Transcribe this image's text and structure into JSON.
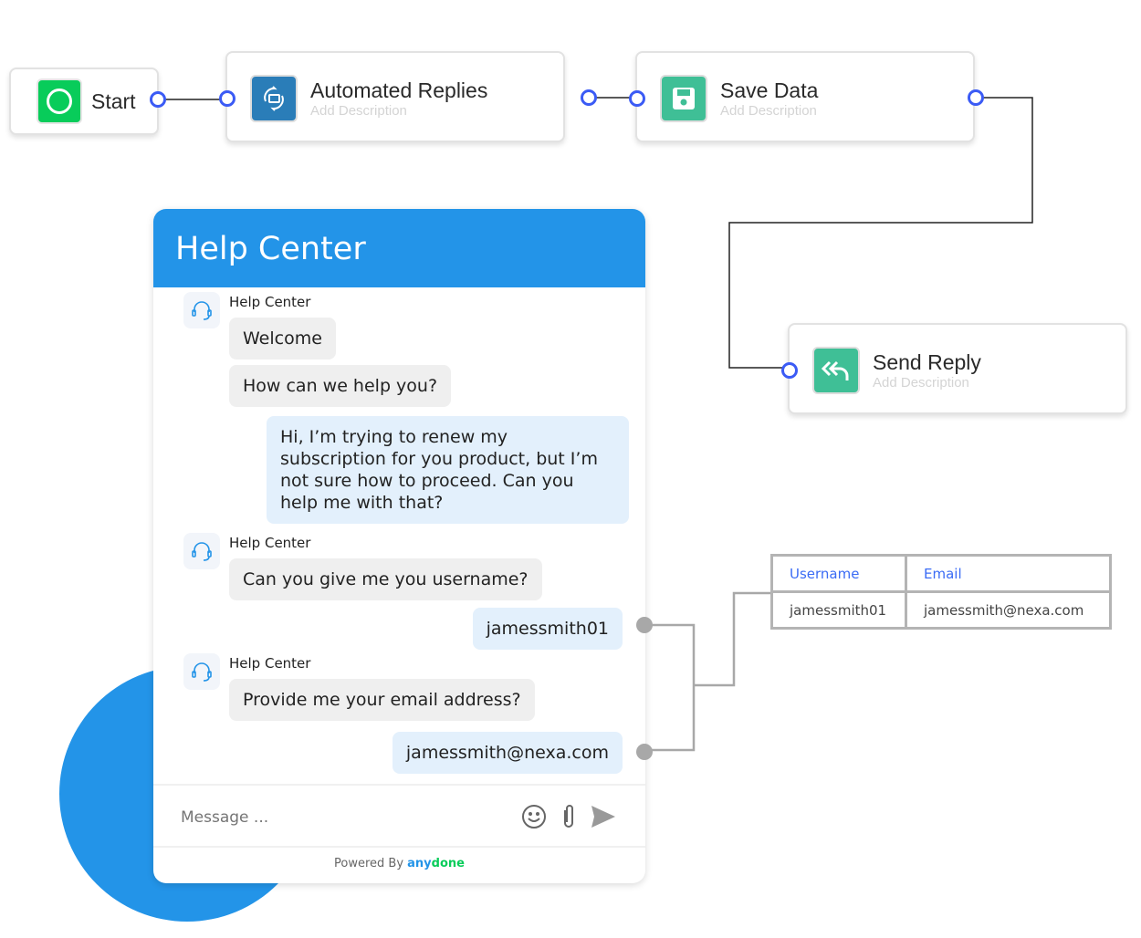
{
  "flow": {
    "start": {
      "label": "Start",
      "color": "#08cc5a"
    },
    "nodes": [
      {
        "title": "Automated Replies",
        "description": "Add Description",
        "icon": "refresh-message-icon",
        "color": "#2a7db8"
      },
      {
        "title": "Save Data",
        "description": "Add Description",
        "icon": "floppy-disk-icon",
        "color": "#3fbf96"
      },
      {
        "title": "Send Reply",
        "description": "Add Description",
        "icon": "reply-all-icon",
        "color": "#3fbf96"
      }
    ]
  },
  "chat": {
    "title": "Help Center",
    "accent": "#2394e8",
    "messages": [
      {
        "sender": "Help Center",
        "bubbles": [
          "Welcome",
          "How can we help you?"
        ]
      },
      {
        "user": "Hi, I’m trying to renew my subscription for you product, but I’m not sure how to proceed. Can you help me with that?"
      },
      {
        "sender": "Help Center",
        "bubbles": [
          "Can you give me you username?"
        ]
      },
      {
        "user": "jamessmith01"
      },
      {
        "sender": "Help Center",
        "bubbles": [
          "Provide me your email address?"
        ]
      },
      {
        "user": "jamessmith@nexa.com"
      }
    ],
    "input_placeholder": "Message ...",
    "powered_by": "Powered By",
    "brand_a": "any",
    "brand_b": "done"
  },
  "table": {
    "headers": [
      "Username",
      "Email"
    ],
    "row": [
      "jamessmith01",
      "jamessmith@nexa.com"
    ]
  }
}
